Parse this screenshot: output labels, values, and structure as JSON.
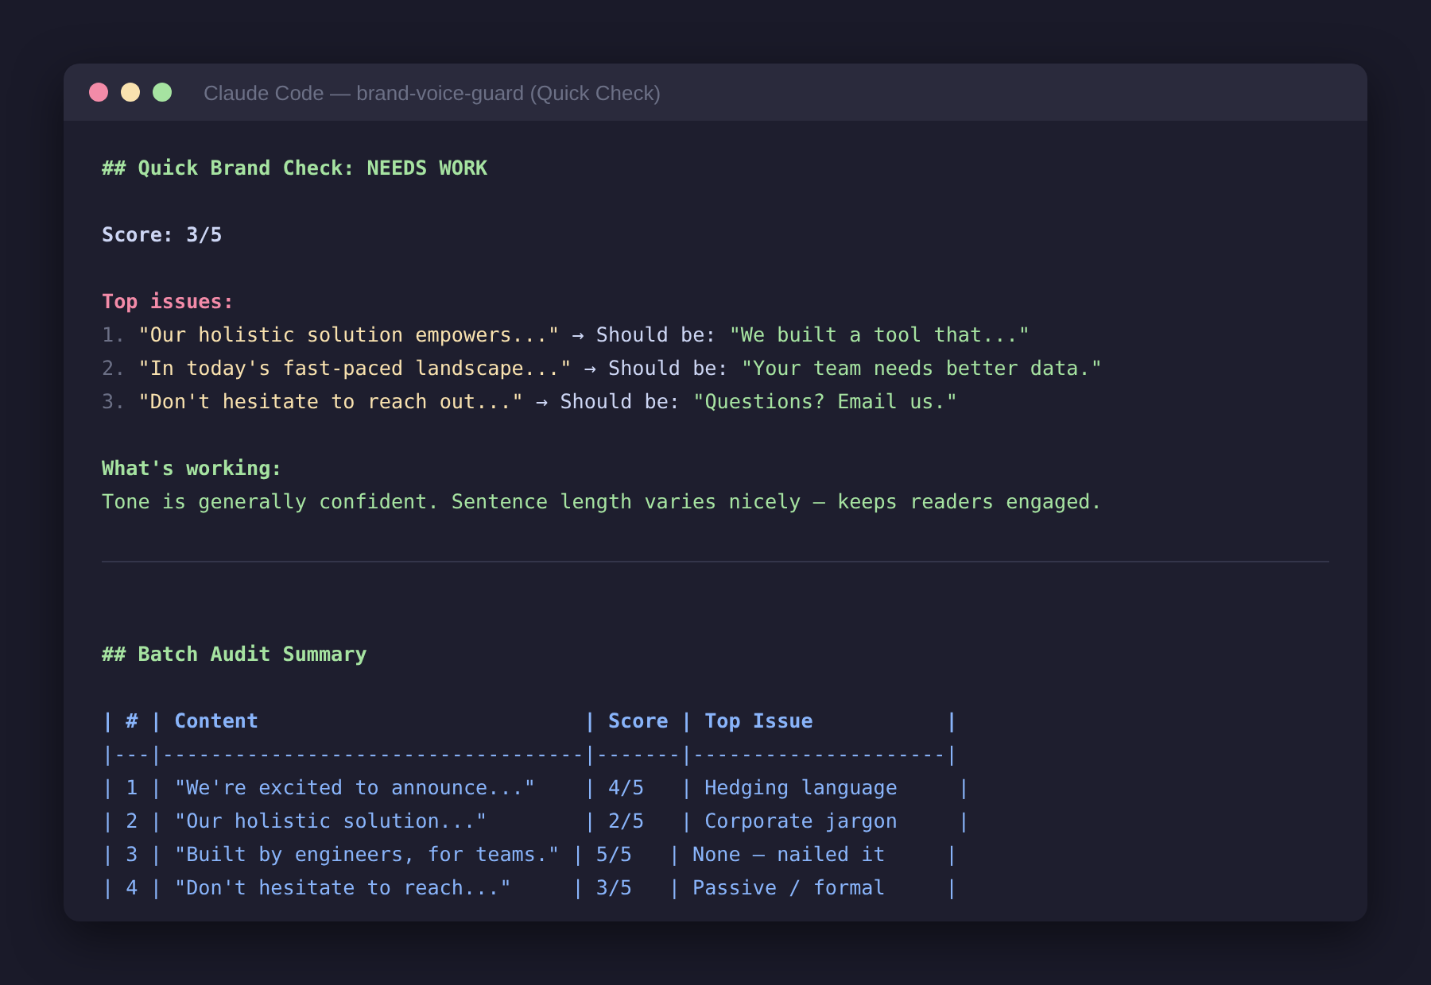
{
  "window": {
    "title": "Claude Code — brand-voice-guard (Quick Check)"
  },
  "quick_check": {
    "heading": "## Quick Brand Check: NEEDS WORK",
    "score": "Score: 3/5",
    "issues_label": "Top issues:",
    "issues": [
      {
        "number": "1.",
        "original": "\"Our holistic solution empowers...\"",
        "arrow": "→",
        "should_label": "Should be:",
        "suggestion": "\"We built a tool that...\""
      },
      {
        "number": "2.",
        "original": "\"In today's fast-paced landscape...\"",
        "arrow": "→",
        "should_label": "Should be:",
        "suggestion": "\"Your team needs better data.\""
      },
      {
        "number": "3.",
        "original": "\"Don't hesitate to reach out...\"",
        "arrow": "→",
        "should_label": "Should be:",
        "suggestion": "\"Questions? Email us.\""
      }
    ],
    "working_label": "What's working:",
    "working_text": "Tone is generally confident. Sentence length varies nicely — keeps readers engaged."
  },
  "batch": {
    "heading": "## Batch Audit Summary",
    "table_lines": [
      {
        "kind": "header",
        "text": "| # | Content                           | Score | Top Issue           |"
      },
      {
        "kind": "rule",
        "text": "|---|-----------------------------------|-------|---------------------|"
      },
      {
        "kind": "row",
        "text": "| 1 | \"We're excited to announce...\"    | 4/5   | Hedging language     |"
      },
      {
        "kind": "row",
        "text": "| 2 | \"Our holistic solution...\"        | 2/5   | Corporate jargon     |"
      },
      {
        "kind": "row",
        "text": "| 3 | \"Built by engineers, for teams.\" | 5/5   | None — nailed it     |"
      },
      {
        "kind": "row",
        "text": "| 4 | \"Don't hesitate to reach...\"     | 3/5   | Passive / formal     |"
      }
    ]
  }
}
